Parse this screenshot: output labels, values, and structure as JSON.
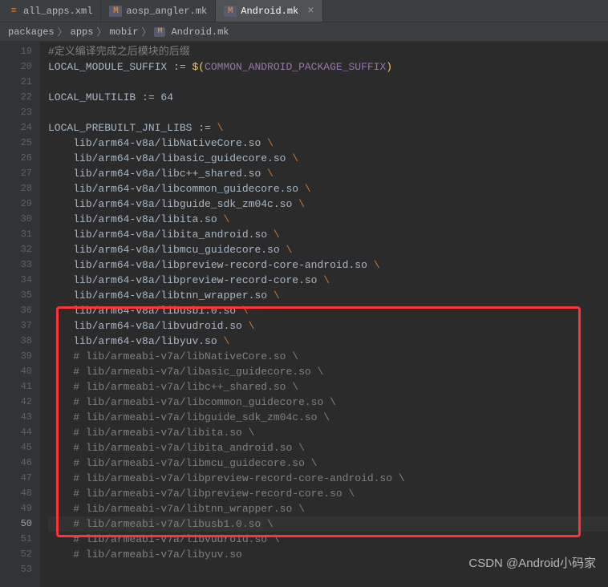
{
  "tabs": [
    {
      "icon": "≡",
      "iconClass": "xml",
      "label": "all_apps.xml",
      "active": false
    },
    {
      "icon": "M",
      "iconClass": "mk",
      "label": "aosp_angler.mk",
      "active": false
    },
    {
      "icon": "M",
      "iconClass": "mk",
      "label": "Android.mk",
      "active": true
    }
  ],
  "breadcrumb": {
    "parts": [
      "packages",
      "apps",
      "mobir"
    ],
    "fileIcon": "M",
    "fileName": "Android.mk"
  },
  "gutter": {
    "start": 19,
    "end": 53,
    "current": 50
  },
  "lines": [
    {
      "n": 1,
      "segs": [
        {
          "c": "comment",
          "t": "#定义编译完成之后模块的后缀"
        }
      ]
    },
    {
      "n": 1,
      "segs": [
        {
          "c": "normal",
          "t": "LOCAL_MODULE_SUFFIX := "
        },
        {
          "c": "func",
          "t": "$("
        },
        {
          "c": "var",
          "t": "COMMON_ANDROID_PACKAGE_SUFFIX"
        },
        {
          "c": "func",
          "t": ")"
        }
      ]
    },
    {
      "n": 1,
      "segs": []
    },
    {
      "n": 1,
      "segs": [
        {
          "c": "normal",
          "t": "LOCAL_MULTILIB := 64"
        }
      ]
    },
    {
      "n": 1,
      "segs": []
    },
    {
      "n": 1,
      "segs": [
        {
          "c": "normal",
          "t": "LOCAL_PREBUILT_JNI_LIBS := "
        },
        {
          "c": "escape",
          "t": "\\"
        }
      ]
    },
    {
      "n": 2,
      "segs": [
        {
          "c": "normal",
          "t": "lib/arm64-v8a/libNativeCore.so "
        },
        {
          "c": "escape",
          "t": "\\"
        }
      ]
    },
    {
      "n": 2,
      "segs": [
        {
          "c": "normal",
          "t": "lib/arm64-v8a/libasic_guidecore.so "
        },
        {
          "c": "escape",
          "t": "\\"
        }
      ]
    },
    {
      "n": 2,
      "segs": [
        {
          "c": "normal",
          "t": "lib/arm64-v8a/libc++_shared.so "
        },
        {
          "c": "escape",
          "t": "\\"
        }
      ]
    },
    {
      "n": 2,
      "segs": [
        {
          "c": "normal",
          "t": "lib/arm64-v8a/libcommon_guidecore.so "
        },
        {
          "c": "escape",
          "t": "\\"
        }
      ]
    },
    {
      "n": 2,
      "segs": [
        {
          "c": "normal",
          "t": "lib/arm64-v8a/libguide_sdk_zm04c.so "
        },
        {
          "c": "escape",
          "t": "\\"
        }
      ]
    },
    {
      "n": 2,
      "segs": [
        {
          "c": "normal",
          "t": "lib/arm64-v8a/libita.so "
        },
        {
          "c": "escape",
          "t": "\\"
        }
      ]
    },
    {
      "n": 2,
      "segs": [
        {
          "c": "normal",
          "t": "lib/arm64-v8a/libita_android.so "
        },
        {
          "c": "escape",
          "t": "\\"
        }
      ]
    },
    {
      "n": 2,
      "segs": [
        {
          "c": "normal",
          "t": "lib/arm64-v8a/libmcu_guidecore.so "
        },
        {
          "c": "escape",
          "t": "\\"
        }
      ]
    },
    {
      "n": 2,
      "segs": [
        {
          "c": "normal",
          "t": "lib/arm64-v8a/libpreview-record-core-android.so "
        },
        {
          "c": "escape",
          "t": "\\"
        }
      ]
    },
    {
      "n": 2,
      "segs": [
        {
          "c": "normal",
          "t": "lib/arm64-v8a/libpreview-record-core.so "
        },
        {
          "c": "escape",
          "t": "\\"
        }
      ]
    },
    {
      "n": 2,
      "segs": [
        {
          "c": "normal",
          "t": "lib/arm64-v8a/libtnn_wrapper.so "
        },
        {
          "c": "escape",
          "t": "\\"
        }
      ]
    },
    {
      "n": 2,
      "segs": [
        {
          "c": "normal",
          "t": "lib/arm64-v8a/libusb1.0.so "
        },
        {
          "c": "escape",
          "t": "\\"
        }
      ]
    },
    {
      "n": 2,
      "segs": [
        {
          "c": "normal",
          "t": "lib/arm64-v8a/libvudroid.so "
        },
        {
          "c": "escape",
          "t": "\\"
        }
      ]
    },
    {
      "n": 2,
      "segs": [
        {
          "c": "normal",
          "t": "lib/arm64-v8a/libyuv.so "
        },
        {
          "c": "escape",
          "t": "\\"
        }
      ]
    },
    {
      "n": 2,
      "segs": [
        {
          "c": "comment",
          "t": "# lib/armeabi-v7a/libNativeCore.so \\"
        }
      ]
    },
    {
      "n": 2,
      "segs": [
        {
          "c": "comment",
          "t": "# lib/armeabi-v7a/libasic_guidecore.so \\"
        }
      ]
    },
    {
      "n": 2,
      "segs": [
        {
          "c": "comment",
          "t": "# lib/armeabi-v7a/libc++_shared.so \\"
        }
      ]
    },
    {
      "n": 2,
      "segs": [
        {
          "c": "comment",
          "t": "# lib/armeabi-v7a/libcommon_guidecore.so \\"
        }
      ]
    },
    {
      "n": 2,
      "segs": [
        {
          "c": "comment",
          "t": "# lib/armeabi-v7a/libguide_sdk_zm04c.so \\"
        }
      ]
    },
    {
      "n": 2,
      "segs": [
        {
          "c": "comment",
          "t": "# lib/armeabi-v7a/libita.so \\"
        }
      ]
    },
    {
      "n": 2,
      "segs": [
        {
          "c": "comment",
          "t": "# lib/armeabi-v7a/libita_android.so \\"
        }
      ]
    },
    {
      "n": 2,
      "segs": [
        {
          "c": "comment",
          "t": "# lib/armeabi-v7a/libmcu_guidecore.so \\"
        }
      ]
    },
    {
      "n": 2,
      "segs": [
        {
          "c": "comment",
          "t": "# lib/armeabi-v7a/libpreview-record-core-android.so \\"
        }
      ]
    },
    {
      "n": 2,
      "segs": [
        {
          "c": "comment",
          "t": "# lib/armeabi-v7a/libpreview-record-core.so \\"
        }
      ]
    },
    {
      "n": 2,
      "segs": [
        {
          "c": "comment",
          "t": "# lib/armeabi-v7a/libtnn_wrapper.so \\"
        }
      ]
    },
    {
      "n": 2,
      "segs": [
        {
          "c": "comment",
          "t": "# lib/armeabi-v7a/libusb1.0.so \\"
        }
      ],
      "current": true
    },
    {
      "n": 2,
      "segs": [
        {
          "c": "comment",
          "t": "# lib/armeabi-v7a/libvudroid.so \\"
        }
      ]
    },
    {
      "n": 2,
      "segs": [
        {
          "c": "comment",
          "t": "# lib/armeabi-v7a/libyuv.so"
        }
      ]
    },
    {
      "n": 1,
      "segs": []
    }
  ],
  "watermark": "CSDN @Android小码家"
}
